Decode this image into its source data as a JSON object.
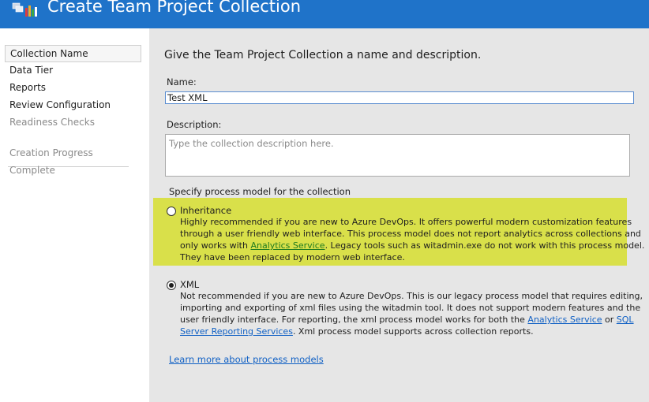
{
  "window": {
    "title": "Create Team Project Collection"
  },
  "sidebar": {
    "items": [
      {
        "label": "Collection Name"
      },
      {
        "label": "Data Tier"
      },
      {
        "label": "Reports"
      },
      {
        "label": "Review Configuration"
      },
      {
        "label": "Readiness Checks"
      },
      {
        "label": "Creation Progress"
      },
      {
        "label": "Complete"
      }
    ]
  },
  "main": {
    "heading": "Give the Team Project Collection a name and description.",
    "name_label": "Name:",
    "name_value": "Test XML",
    "description_label": "Description:",
    "description_placeholder": "Type the collection description here.",
    "process_label": "Specify process model for the collection",
    "inheritance": {
      "title": "Inheritance",
      "line1": "Highly recommended if you are new to Azure DevOps. It offers powerful modern customization features",
      "line2": "through a user friendly web interface. This process model does not report analytics across collections and",
      "line3_pre": "only works with ",
      "line3_link": "Analytics Service",
      "line3_post": ". Legacy tools such as witadmin.exe do not work with this process model.",
      "line4": "They have been replaced by modern web interface."
    },
    "xml": {
      "title": "XML",
      "line1": "Not recommended if you are new to Azure DevOps. This is our legacy process model that requires editing,",
      "line2": "importing and exporting of xml files using the witadmin tool. It does not support modern features and the",
      "line3_pre": "user friendly interface. For reporting, the xml process model works for both the ",
      "line3_link1": "Analytics Service",
      "line3_mid": " or ",
      "line3_link2": "SQL",
      "line4_link": "Server Reporting Services",
      "line4_post": ". Xml process model supports across collection reports."
    },
    "learn_more": "Learn more about process models"
  },
  "colors": {
    "titlebar": "#1f73c9",
    "highlight": "#d9e04a",
    "link": "#1060c4"
  }
}
